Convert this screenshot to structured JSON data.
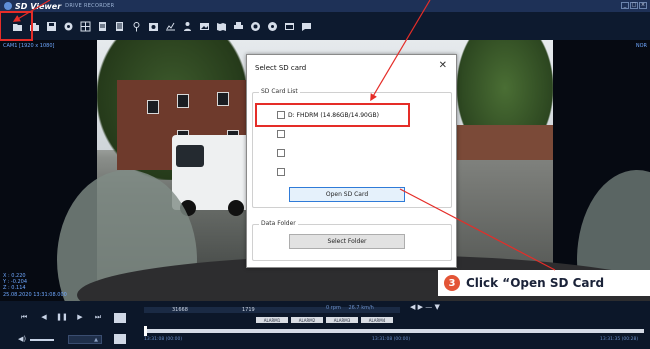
{
  "title_bar": {
    "app_name": "SD Viewer",
    "subtitle": "DRIVE RECORDER"
  },
  "toolbar": {
    "icons": [
      "folder-icon",
      "open-icon",
      "save-icon",
      "settings-icon",
      "grid-icon",
      "doc-icon",
      "doc2-icon",
      "pin-icon",
      "capture-icon",
      "chart-icon",
      "people-icon",
      "image-icon",
      "map-icon",
      "print-icon",
      "record-icon",
      "target-icon",
      "window-icon",
      "chat-icon"
    ]
  },
  "video": {
    "cam_label": "CAM1 [1920 x 1080]",
    "nor_label": "NOR",
    "gsensor": {
      "x": "X : 0.220",
      "y": "Y : -0.204",
      "z": "Z : 0.114"
    },
    "timestamp": "25.08.2020 13:31:08.000"
  },
  "dialog": {
    "title": "Select SD card",
    "close": "✕",
    "sd_card_list_label": "SD Card List",
    "sd_entry": "D: FHDRM (14.86GB/14.90GB)",
    "open_sd_card_button": "Open SD Card",
    "data_folder_label": "Data Folder",
    "select_folder_button": "Select Folder"
  },
  "callout": {
    "number": "3",
    "text": "Click “Open SD Card"
  },
  "playback": {
    "frame_left": "31668",
    "frame_right": "1719",
    "speed_rpm": "0 rpm",
    "speed_kmh": "26.7 km/h",
    "nav_arrows": "◀ ▶ — ▼",
    "alarms": [
      "ALARM1",
      "ALARM2",
      "ALARM3",
      "ALARM4"
    ],
    "time_start": "13:31:08 (00:00)",
    "time_mid": "13:31:08 (00:00)",
    "time_end": "13:31:35 (00:28)"
  },
  "colors": {
    "accent_red": "#e52d28",
    "callout_badge": "#e35436",
    "app_bg": "#0b1526"
  }
}
